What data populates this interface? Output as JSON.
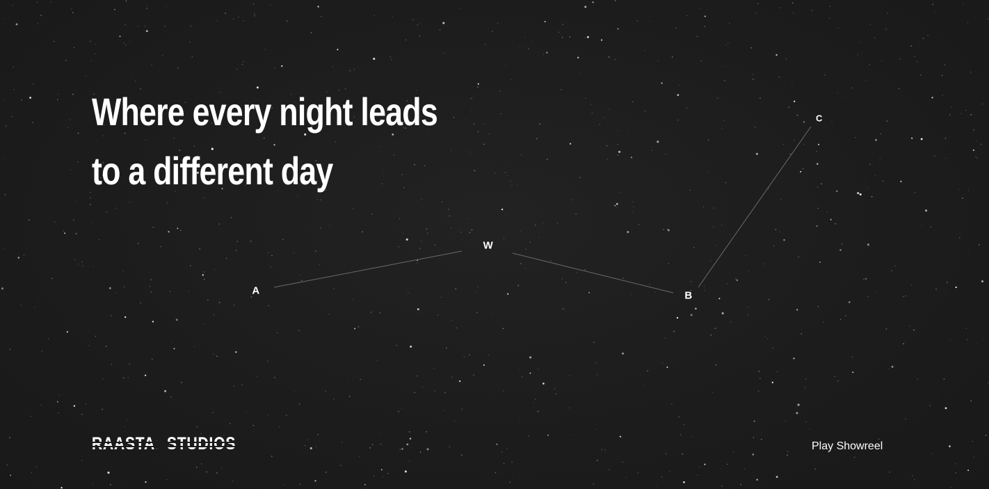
{
  "headline": {
    "line1": "Where every night leads",
    "line2": "to a different day"
  },
  "constellation": {
    "nodes": {
      "a": "A",
      "w": "W",
      "b": "B",
      "c": "C"
    },
    "line_color": "#6b6b6b"
  },
  "footer": {
    "logo_word1": "RAASTA",
    "logo_word2": "STUDIOS",
    "showreel_label": "Play Showreel"
  },
  "colors": {
    "background": "#1c1c1c",
    "text": "#ffffff",
    "star": "#ffffff"
  }
}
